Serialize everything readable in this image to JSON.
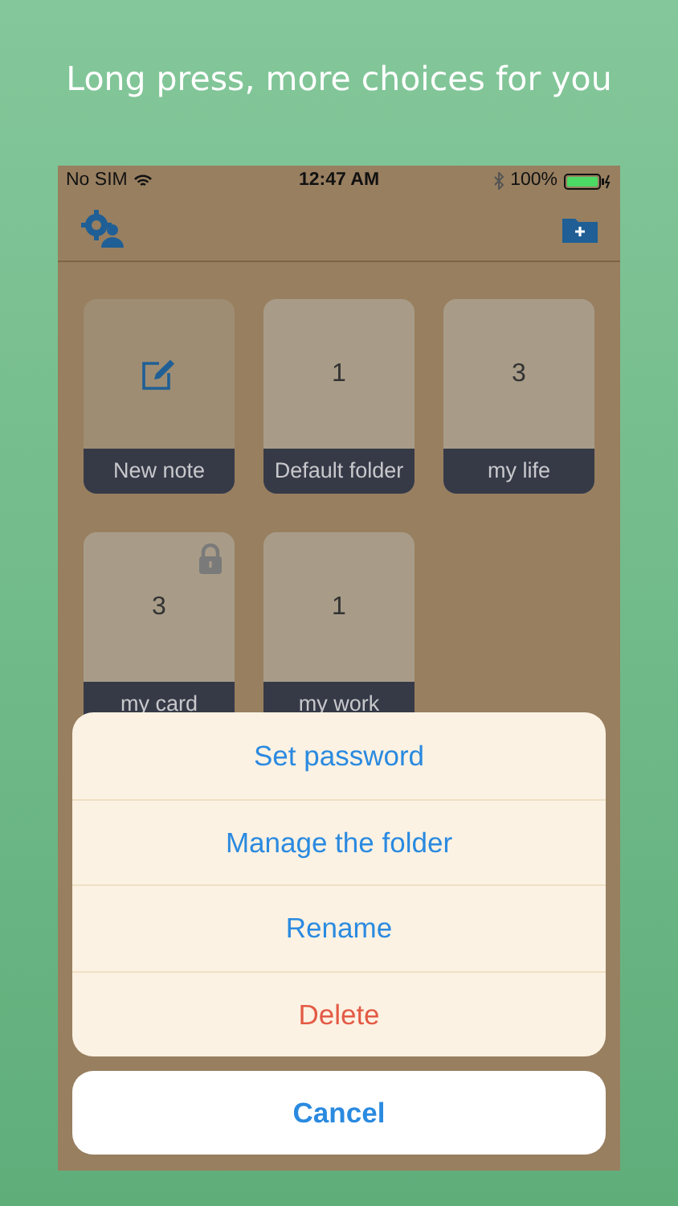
{
  "headline": "Long press,  more choices for you",
  "status_bar": {
    "carrier": "No SIM",
    "time": "12:47 AM",
    "battery": "100%"
  },
  "folders": [
    {
      "kind": "new",
      "label": "New note",
      "locked": false
    },
    {
      "kind": "folder",
      "count": "1",
      "label": "Default folder",
      "locked": false
    },
    {
      "kind": "folder",
      "count": "3",
      "label": "my life",
      "locked": false
    },
    {
      "kind": "folder",
      "count": "3",
      "label": "my card",
      "locked": true
    },
    {
      "kind": "folder",
      "count": "1",
      "label": "my work",
      "locked": false
    }
  ],
  "action_sheet": {
    "actions": [
      {
        "label": "Set password",
        "destructive": false
      },
      {
        "label": "Manage the folder",
        "destructive": false
      },
      {
        "label": "Rename",
        "destructive": false
      },
      {
        "label": "Delete",
        "destructive": true
      }
    ],
    "cancel": "Cancel"
  }
}
